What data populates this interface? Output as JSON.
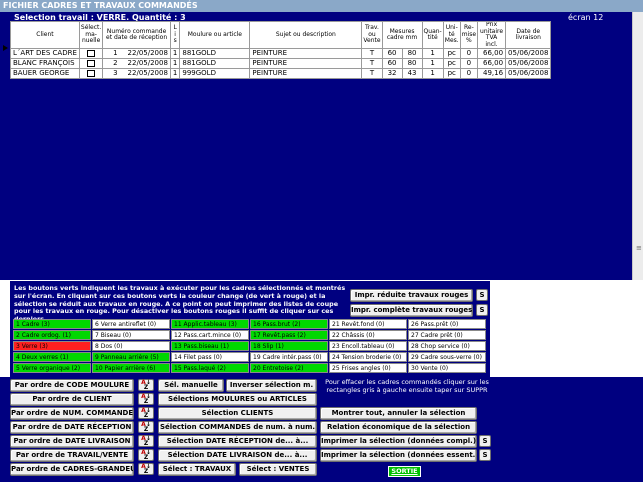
{
  "title": "FICHIER CADRES ET TRAVAUX COMMANDÉS",
  "selection_info": "Selection travail : VERRE.  Quantité : 3",
  "screen_label": "écran 12",
  "table": {
    "headers": [
      "Client",
      "Sélect. ma-nuelle",
      "Numéro commande et date de réception",
      "L i s",
      "Moulure ou article",
      "Sujet ou description",
      "Trav. ou Vente",
      "Mesures cadre mm",
      "",
      "Quan-tité",
      "Uni-té Mes.",
      "Re-mise %",
      "Prix unitaire TVA incl.",
      "Date de livraison"
    ],
    "rows": [
      {
        "client": "L´ART DES CADRE",
        "num": "1",
        "date": "22/05/2008",
        "lis": "1",
        "article": "881GOLD",
        "sujet": "PEINTURE",
        "tv": "T",
        "w": "60",
        "h": "80",
        "qty": "1",
        "unit": "pc",
        "remise": "0",
        "prix": "66,00",
        "livraison": "05/06/2008"
      },
      {
        "client": "BLANC FRANÇOIS",
        "num": "2",
        "date": "22/05/2008",
        "lis": "1",
        "article": "881GOLD",
        "sujet": "PEINTURE",
        "tv": "T",
        "w": "60",
        "h": "80",
        "qty": "1",
        "unit": "pc",
        "remise": "0",
        "prix": "66,00",
        "livraison": "05/06/2008"
      },
      {
        "client": "BAUER GEORGE",
        "num": "3",
        "date": "22/05/2008",
        "lis": "1",
        "article": "999GOLD",
        "sujet": "PEINTURE",
        "tv": "T",
        "w": "32",
        "h": "43",
        "qty": "1",
        "unit": "pc",
        "remise": "0",
        "prix": "49,16",
        "livraison": "05/06/2008"
      }
    ]
  },
  "info_text": "Les boutons verts indiquent les travaux à exécuter pour les cadres sélectionnés et montrés sur l'écran. En cliquant sur ces boutons verts la couleur change (de vert à rouge) et la sélection se réduit aux travaux en rouge. A ce point on peut imprimer des listes de coupe pour les travaux en rouge. Pour désactiver les boutons rouges il suffit de cliquer sur ces derniers.",
  "print_buttons": {
    "reduced": "Impr. réduite travaux rouges",
    "complete": "Impr. complète travaux rouges",
    "s": "S"
  },
  "jobs": [
    {
      "label": "1  Cadre (3)",
      "state": "g"
    },
    {
      "label": "6  Verre antireflet (0)",
      "state": "w"
    },
    {
      "label": "11  Applic.tableau (3)",
      "state": "g"
    },
    {
      "label": "16  Pass.brut (2)",
      "state": "g"
    },
    {
      "label": "21  Revêt.fond (0)",
      "state": "w"
    },
    {
      "label": "26  Pass.prêt (0)",
      "state": "w"
    },
    {
      "label": "2  Cadre ordog. (1)",
      "state": "g"
    },
    {
      "label": "7  Biseau (0)",
      "state": "w"
    },
    {
      "label": "12  Pass.cart.mince (0)",
      "state": "w"
    },
    {
      "label": "17  Revêt.pass (2)",
      "state": "g"
    },
    {
      "label": "22  Châssis (0)",
      "state": "w"
    },
    {
      "label": "27  Cadre prêt (0)",
      "state": "w"
    },
    {
      "label": "3  Verre (3)",
      "state": "r"
    },
    {
      "label": "8  Dos (0)",
      "state": "w"
    },
    {
      "label": "13  Pass.biseau (1)",
      "state": "g"
    },
    {
      "label": "18  Slip (1)",
      "state": "g"
    },
    {
      "label": "23  Encoll.tableau (0)",
      "state": "w"
    },
    {
      "label": "28  Chop service (0)",
      "state": "w"
    },
    {
      "label": "4  Deux verres (1)",
      "state": "g"
    },
    {
      "label": "9  Panneau arrière (5)",
      "state": "g"
    },
    {
      "label": "14  Filet pass (0)",
      "state": "w"
    },
    {
      "label": "19  Cadre intér.pass (0)",
      "state": "w"
    },
    {
      "label": "24  Tension broderie (0)",
      "state": "w"
    },
    {
      "label": "29  Cadre sous-verre (0)",
      "state": "w"
    },
    {
      "label": "5  Verre organique (2)",
      "state": "g"
    },
    {
      "label": "10  Papier arrière (6)",
      "state": "g"
    },
    {
      "label": "15  Pass.laqué (2)",
      "state": "g"
    },
    {
      "label": "20  Entretoise (2)",
      "state": "g"
    },
    {
      "label": "25  Frises angles (0)",
      "state": "w"
    },
    {
      "label": "30  Vente (0)",
      "state": "w"
    }
  ],
  "sort_buttons": [
    "Par ordre de CODE MOULURE",
    "Par ordre de CLIENT",
    "Par ordre de NUM. COMMANDE",
    "Par ordre de DATE RÉCEPTION",
    "Par ordre de DATE LIVRAISON",
    "Par ordre de TRAVAIL/VENTE",
    "Par ordre de CADRES-GRANDEUR"
  ],
  "sort_icon": {
    "a": "A",
    "z": "Z"
  },
  "mid_buttons": {
    "sel_manuelle": "Sél. manuelle",
    "inverser": "Inverser sélection m.",
    "moulures": "Sélections MOULURES ou ARTICLES",
    "clients": "Sélection CLIENTS",
    "commandes": "Sélection COMMANDES de num. à num.",
    "reception": "Sélection DATE RÉCEPTION de... à...",
    "livraison": "Sélection DATE LIVRAISON de... à...",
    "travaux": "Sélect : TRAVAUX",
    "ventes": "Sélect : VENTES"
  },
  "note": "Pour effacer les cadres commandés cliquer sur les rectangles gris à gauche ensuite taper sur SUPPR",
  "right_buttons": {
    "montrer": "Montrer tout, annuler la sélection",
    "relation": "Relation économique de la sélection",
    "impr_compl": "Imprimer la sélection (données compl.)",
    "impr_essent": "Imprimer la sélection (données essent.)",
    "s": "S",
    "sortie": "SORTIE"
  }
}
